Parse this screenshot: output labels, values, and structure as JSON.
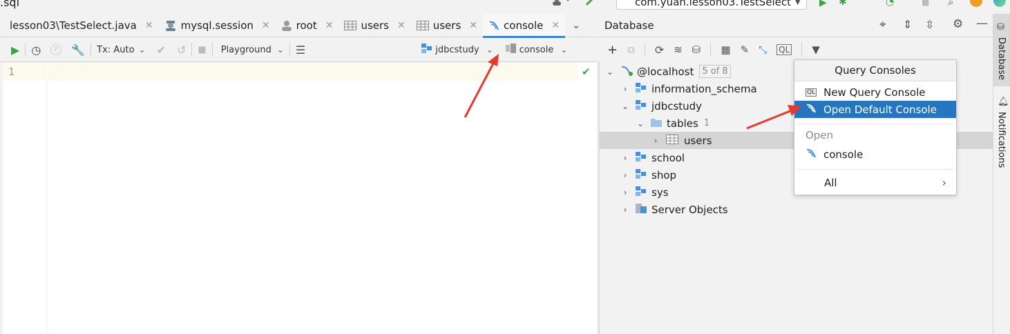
{
  "topbar": {
    "file_fragment": ".sql",
    "run_config": "com.yuan.lesson03.TestSelect"
  },
  "editor_tabs": [
    {
      "label": "lesson03\\TestSelect.java",
      "icon": "none"
    },
    {
      "label": "mysql.session",
      "icon": "session-icon"
    },
    {
      "label": "root",
      "icon": "user-icon"
    },
    {
      "label": "users",
      "icon": "table-icon"
    },
    {
      "label": "users",
      "icon": "table-icon"
    },
    {
      "label": "console",
      "icon": "mysql-icon"
    }
  ],
  "editor_toolbar": {
    "tx_label": "Tx: Auto",
    "playground_label": "Playground",
    "schema_label": "jdbcstudy",
    "session_label": "console"
  },
  "editor": {
    "line_number": "1"
  },
  "database_panel": {
    "title": "Database",
    "tree": [
      {
        "label": "@localhost",
        "badge": "5 of 8",
        "level": 0,
        "expanded": true
      },
      {
        "label": "information_schema",
        "level": 1,
        "expanded": false
      },
      {
        "label": "jdbcstudy",
        "level": 1,
        "expanded": true
      },
      {
        "label": "tables",
        "count": "1",
        "level": 2,
        "expanded": true
      },
      {
        "label": "users",
        "level": 3,
        "expanded": false,
        "selected": true
      },
      {
        "label": "school",
        "level": 1,
        "expanded": false
      },
      {
        "label": "shop",
        "level": 1,
        "expanded": false
      },
      {
        "label": "sys",
        "level": 1,
        "expanded": false
      },
      {
        "label": "Server Objects",
        "level": 1,
        "expanded": false
      }
    ]
  },
  "popup": {
    "title": "Query Consoles",
    "new_console": "New Query Console",
    "open_default": "Open Default Console",
    "section_open": "Open",
    "console_item": "console",
    "all_item": "All"
  },
  "side_strip": {
    "database_tab": "Database",
    "notifications_tab": "Notifications"
  },
  "colors": {
    "accent": "#2675bf",
    "annotation_arrow": "#e8392f",
    "run_green": "#3fa14a"
  }
}
